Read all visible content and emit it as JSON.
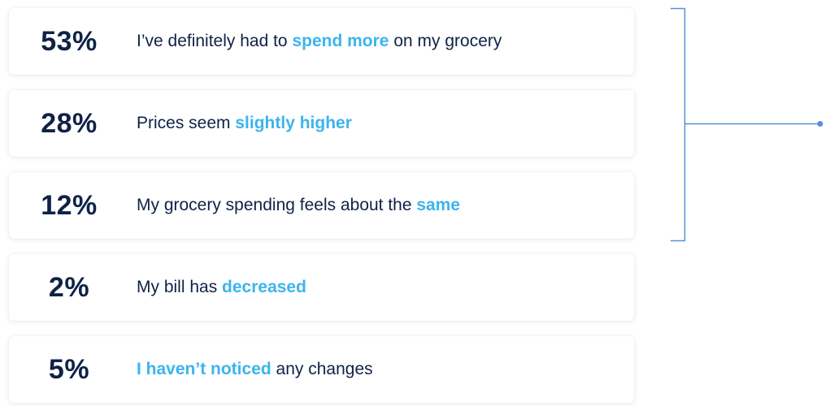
{
  "chart_data": {
    "type": "table",
    "rows": [
      {
        "percent": "53%",
        "value": 53,
        "segments": [
          {
            "text": "I’ve definitely had to ",
            "highlight": false
          },
          {
            "text": "spend more",
            "highlight": true
          },
          {
            "text": " on my grocery",
            "highlight": false
          }
        ]
      },
      {
        "percent": "28%",
        "value": 28,
        "segments": [
          {
            "text": "Prices seem ",
            "highlight": false
          },
          {
            "text": "slightly higher",
            "highlight": true
          }
        ]
      },
      {
        "percent": "12%",
        "value": 12,
        "segments": [
          {
            "text": "My grocery spending feels about the ",
            "highlight": false
          },
          {
            "text": "same",
            "highlight": true
          }
        ]
      },
      {
        "percent": "2%",
        "value": 2,
        "segments": [
          {
            "text": "My bill has ",
            "highlight": false
          },
          {
            "text": "decreased",
            "highlight": true
          }
        ]
      },
      {
        "percent": "5%",
        "value": 5,
        "segments": [
          {
            "text": "I ",
            "highlight": true
          },
          {
            "text": "haven’t noticed",
            "highlight": true
          },
          {
            "text": " any changes",
            "highlight": false
          }
        ]
      }
    ],
    "bracketed_rows": [
      0,
      1,
      2
    ]
  },
  "colors": {
    "text": "#0f2246",
    "highlight": "#3cb4ec",
    "bracket": "#5b8fd8"
  }
}
